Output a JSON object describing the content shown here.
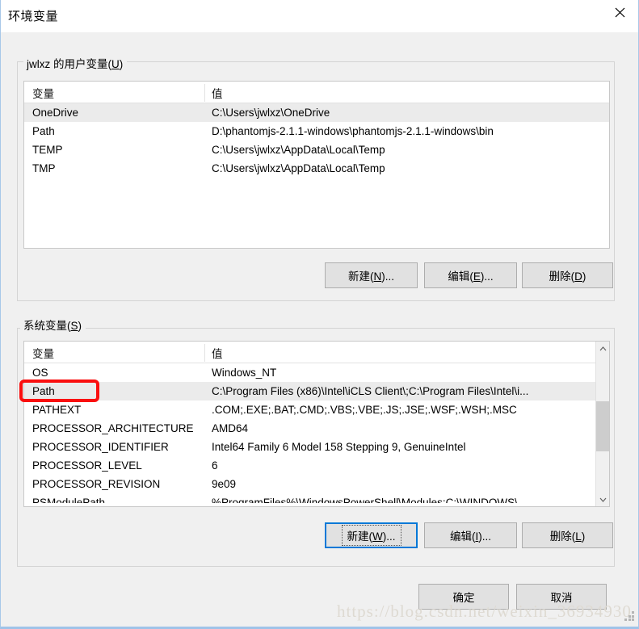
{
  "window": {
    "title": "环境变量",
    "close_icon": "close-icon"
  },
  "user_section": {
    "legend_prefix": "jwlxz 的用户变量(",
    "legend_accel": "U",
    "legend_suffix": ")",
    "columns": [
      "变量",
      "值"
    ],
    "rows": [
      {
        "name": "OneDrive",
        "value": "C:\\Users\\jwlxz\\OneDrive",
        "selected": true
      },
      {
        "name": "Path",
        "value": "D:\\phantomjs-2.1.1-windows\\phantomjs-2.1.1-windows\\bin",
        "selected": false
      },
      {
        "name": "TEMP",
        "value": "C:\\Users\\jwlxz\\AppData\\Local\\Temp",
        "selected": false
      },
      {
        "name": "TMP",
        "value": "C:\\Users\\jwlxz\\AppData\\Local\\Temp",
        "selected": false
      }
    ],
    "buttons": [
      {
        "prefix": "新建(",
        "accel": "N",
        "suffix": ")...",
        "focused": false
      },
      {
        "prefix": "编辑(",
        "accel": "E",
        "suffix": ")...",
        "focused": false
      },
      {
        "prefix": "删除(",
        "accel": "D",
        "suffix": ")",
        "focused": false
      }
    ]
  },
  "system_section": {
    "legend_prefix": "系统变量(",
    "legend_accel": "S",
    "legend_suffix": ")",
    "columns": [
      "变量",
      "值"
    ],
    "rows": [
      {
        "name": "OS",
        "value": "Windows_NT",
        "selected": false
      },
      {
        "name": "Path",
        "value": "C:\\Program Files (x86)\\Intel\\iCLS Client\\;C:\\Program Files\\Intel\\i...",
        "selected": true
      },
      {
        "name": "PATHEXT",
        "value": ".COM;.EXE;.BAT;.CMD;.VBS;.VBE;.JS;.JSE;.WSF;.WSH;.MSC",
        "selected": false
      },
      {
        "name": "PROCESSOR_ARCHITECTURE",
        "value": "AMD64",
        "selected": false
      },
      {
        "name": "PROCESSOR_IDENTIFIER",
        "value": "Intel64 Family 6 Model 158 Stepping 9, GenuineIntel",
        "selected": false
      },
      {
        "name": "PROCESSOR_LEVEL",
        "value": "6",
        "selected": false
      },
      {
        "name": "PROCESSOR_REVISION",
        "value": "9e09",
        "selected": false
      },
      {
        "name": "PSModulePath",
        "value": "%ProgramFiles%\\WindowsPowerShell\\Modules;C:\\WINDOWS\\",
        "selected": false,
        "clipped": true
      }
    ],
    "buttons": [
      {
        "prefix": "新建(",
        "accel": "W",
        "suffix": ")...",
        "focused": true
      },
      {
        "prefix": "编辑(",
        "accel": "I",
        "suffix": ")...",
        "focused": false
      },
      {
        "prefix": "删除(",
        "accel": "L",
        "suffix": ")",
        "focused": false
      }
    ]
  },
  "dialog_buttons": [
    {
      "label": "确定"
    },
    {
      "label": "取消"
    }
  ],
  "annotation": {
    "color": "#fa0f0f",
    "target": "Path"
  },
  "watermark": {
    "text": "https://blog.csdn.net/weixin_36934930"
  }
}
